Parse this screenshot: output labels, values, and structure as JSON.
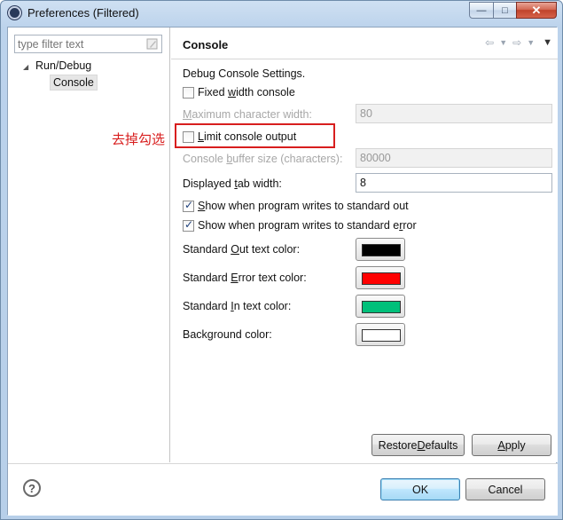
{
  "window": {
    "title": "Preferences (Filtered)",
    "controls": {
      "minimize": "—",
      "maximize": "□",
      "close": "✕"
    }
  },
  "filter": {
    "placeholder": "type filter text"
  },
  "tree": {
    "parent": "Run/Debug",
    "child": "Console"
  },
  "page": {
    "title": "Console",
    "section_heading": "Debug Console Settings.",
    "fixed_width": {
      "pre": "Fixed ",
      "mn": "w",
      "post": "idth console",
      "checked": false
    },
    "max_char_width": {
      "pre": "",
      "mn": "M",
      "post": "aximum character width:",
      "value": "80",
      "enabled": false
    },
    "limit_output": {
      "pre": "",
      "mn": "L",
      "post": "imit console output",
      "checked": false
    },
    "buffer_size": {
      "pre": "Console ",
      "mn": "b",
      "post": "uffer size (characters):",
      "value": "80000",
      "enabled": false
    },
    "tab_width": {
      "pre": "Displayed ",
      "mn": "t",
      "post": "ab width:",
      "value": "8"
    },
    "show_out": {
      "pre": "",
      "mn": "S",
      "post": "how when program writes to standard out",
      "checked": true
    },
    "show_err": {
      "pre": "Show when program writes to standard e",
      "mn": "r",
      "post": "ror",
      "checked": true
    },
    "colors": [
      {
        "pre": "Standard ",
        "mn": "O",
        "post": "ut text color:",
        "swatch": "#000000"
      },
      {
        "pre": "Standard ",
        "mn": "E",
        "post": "rror text color:",
        "swatch": "#ff0000"
      },
      {
        "pre": "Standard ",
        "mn": "I",
        "post": "n text color:",
        "swatch": "#00c07a"
      },
      {
        "pre": "Back",
        "mn": "g",
        "post": "round color:",
        "swatch": "#ffffff"
      }
    ],
    "restore_defaults": {
      "pre": "Restore ",
      "mn": "D",
      "post": "efaults"
    },
    "apply": {
      "pre": "",
      "mn": "A",
      "post": "pply"
    }
  },
  "annotation": {
    "text": "去掉勾选",
    "color": "#d81e1e"
  },
  "footer": {
    "help": "?",
    "ok": "OK",
    "cancel": {
      "pre": "Cancel",
      "mn": "",
      "post": ""
    }
  }
}
